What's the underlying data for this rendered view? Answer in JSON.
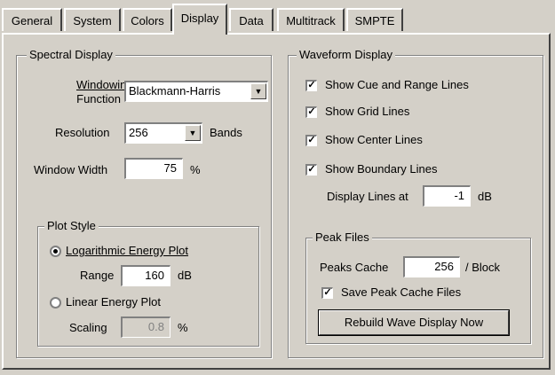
{
  "tabs": [
    {
      "label": "General"
    },
    {
      "label": "System"
    },
    {
      "label": "Colors"
    },
    {
      "label": "Display"
    },
    {
      "label": "Data"
    },
    {
      "label": "Multitrack"
    },
    {
      "label": "SMPTE"
    }
  ],
  "active_tab": "Display",
  "spectral": {
    "title": "Spectral Display",
    "windowing_label_1": "Windowing",
    "windowing_label_2": "Function",
    "windowing_value": "Blackmann-Harris",
    "resolution_label": "Resolution",
    "resolution_value": "256",
    "bands_label": "Bands",
    "window_width_label": "Window Width",
    "window_width_value": "75",
    "window_width_unit": "%",
    "plot_style": {
      "title": "Plot Style",
      "log_label": "Logarithmic Energy Plot",
      "log_selected": true,
      "range_label": "Range",
      "range_value": "160",
      "range_unit": "dB",
      "linear_label": "Linear Energy Plot",
      "linear_selected": false,
      "scaling_label": "Scaling",
      "scaling_value": "0.8",
      "scaling_unit": "%"
    }
  },
  "waveform": {
    "title": "Waveform Display",
    "show_cue": {
      "label": "Show Cue and Range Lines",
      "checked": true
    },
    "show_grid": {
      "label": "Show Grid Lines",
      "checked": true
    },
    "show_center": {
      "label": "Show Center Lines",
      "checked": true
    },
    "show_boundary": {
      "label": "Show Boundary Lines",
      "checked": true
    },
    "display_lines_label": "Display Lines at",
    "display_lines_value": "-1",
    "display_lines_unit": "dB",
    "peak_files": {
      "title": "Peak Files",
      "peaks_cache_label": "Peaks Cache",
      "peaks_cache_value": "256",
      "peaks_cache_unit": "/ Block",
      "save_peak": {
        "label": "Save Peak Cache Files",
        "checked": true
      },
      "rebuild_button": "Rebuild Wave Display Now"
    }
  }
}
